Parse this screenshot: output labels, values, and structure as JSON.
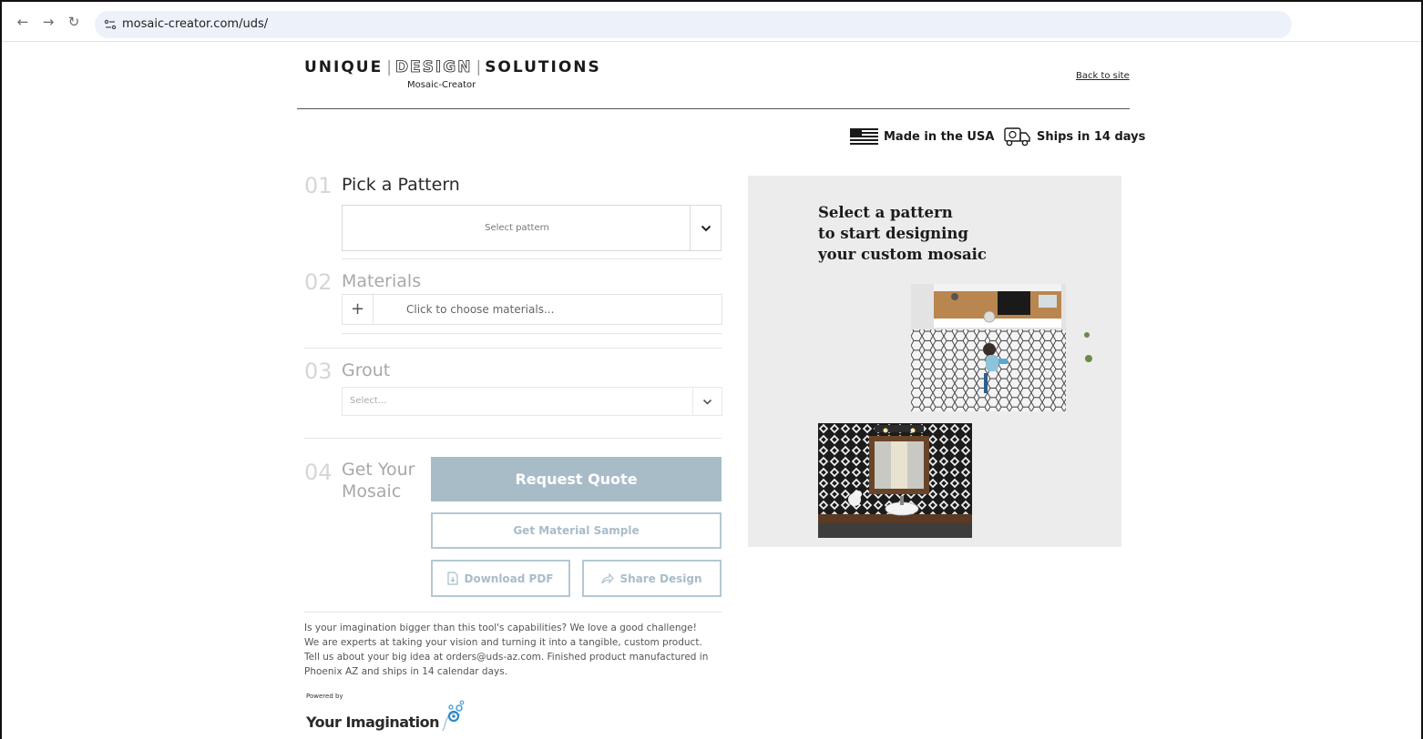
{
  "browser": {
    "url": "mosaic-creator.com/uds/"
  },
  "header": {
    "logo_word1": "UNIQUE",
    "logo_word2": "DESIGN",
    "logo_word3": "SOLUTIONS",
    "logo_subtitle": "Mosaic-Creator",
    "back_link": "Back to site",
    "badge_usa": "Made in the USA",
    "badge_ships": "Ships in 14 days"
  },
  "steps": {
    "pattern": {
      "number": "01",
      "title": "Pick a Pattern",
      "placeholder": "Select pattern"
    },
    "materials": {
      "number": "02",
      "title": "Materials",
      "button_label": "+",
      "placeholder": "Click to choose materials..."
    },
    "grout": {
      "number": "03",
      "title": "Grout",
      "placeholder": "Select..."
    },
    "mosaic": {
      "number": "04",
      "title_line1": "Get Your",
      "title_line2": "Mosaic",
      "quote_label": "Request Quote",
      "sample_label": "Get Material Sample",
      "pdf_label": "Download PDF",
      "share_label": "Share Design"
    }
  },
  "info": {
    "text": "Is your imagination bigger than this tool's capabilities? We love a good challenge! We are experts at taking your vision and turning it into a tangible, custom product. Tell us about your big idea at orders@uds-az.com. Finished product manufactured in Phoenix AZ and ships in 14 calendar days."
  },
  "powered": {
    "small": "Powered by",
    "brand": "Your Imagination"
  },
  "preview": {
    "heading_line1": "Select a pattern",
    "heading_line2": "to start designing",
    "heading_line3": "your custom mosaic"
  },
  "colors": {
    "accent": "#a8bcc8",
    "accent_border": "#b4c8d3",
    "panel_bg": "#ececec",
    "url_bar": "#edf2fa"
  }
}
